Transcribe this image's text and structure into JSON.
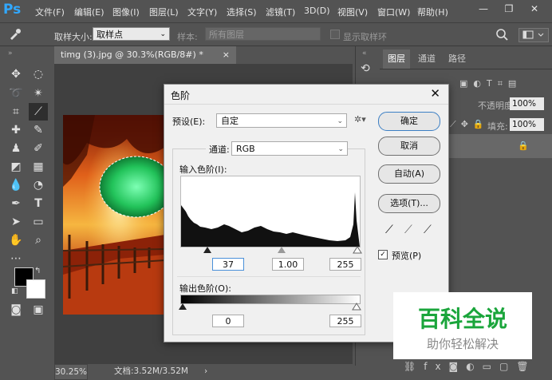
{
  "app": {
    "logo": "Ps"
  },
  "menu": [
    "文件(F)",
    "编辑(E)",
    "图像(I)",
    "图层(L)",
    "文字(Y)",
    "选择(S)",
    "滤镜(T)",
    "3D(D)",
    "视图(V)",
    "窗口(W)",
    "帮助(H)"
  ],
  "window_controls": {
    "minimize": "—",
    "restore": "❐",
    "close": "✕"
  },
  "options": {
    "sample_size_label": "取样大小:",
    "sample_size_value": "取样点",
    "sample_label": "样本:",
    "sample_value": "所有图层",
    "show_ring_label": "显示取样环"
  },
  "document": {
    "tab_title": "timg (3).jpg @ 30.3%(RGB/8#) *",
    "close": "×"
  },
  "status": {
    "zoom": "30.25%",
    "doc_size": "文档:3.52M/3.52M"
  },
  "panels": {
    "tabs": [
      "图层",
      "通道",
      "路径"
    ],
    "opacity_label": "不透明度:",
    "opacity_value": "100%",
    "fill_label": "填充:",
    "fill_value": "100%"
  },
  "levels_dialog": {
    "title": "色阶",
    "preset_label": "预设(E):",
    "preset_value": "自定",
    "channel_label": "通道:",
    "channel_value": "RGB",
    "input_label": "输入色阶(I):",
    "input_black": "37",
    "input_gamma": "1.00",
    "input_white": "255",
    "output_label": "输出色阶(O):",
    "output_black": "0",
    "output_white": "255",
    "buttons": {
      "ok": "确定",
      "cancel": "取消",
      "auto": "自动(A)",
      "options": "选项(T)..."
    },
    "preview_label": "预览(P)",
    "preview_checked": true
  },
  "watermark": {
    "title": "百科全说",
    "subtitle": "助你轻松解决"
  },
  "colors": {
    "accent": "#31a8ff",
    "watermark_green": "#1aa53b",
    "selection_green": "#22c35a"
  }
}
